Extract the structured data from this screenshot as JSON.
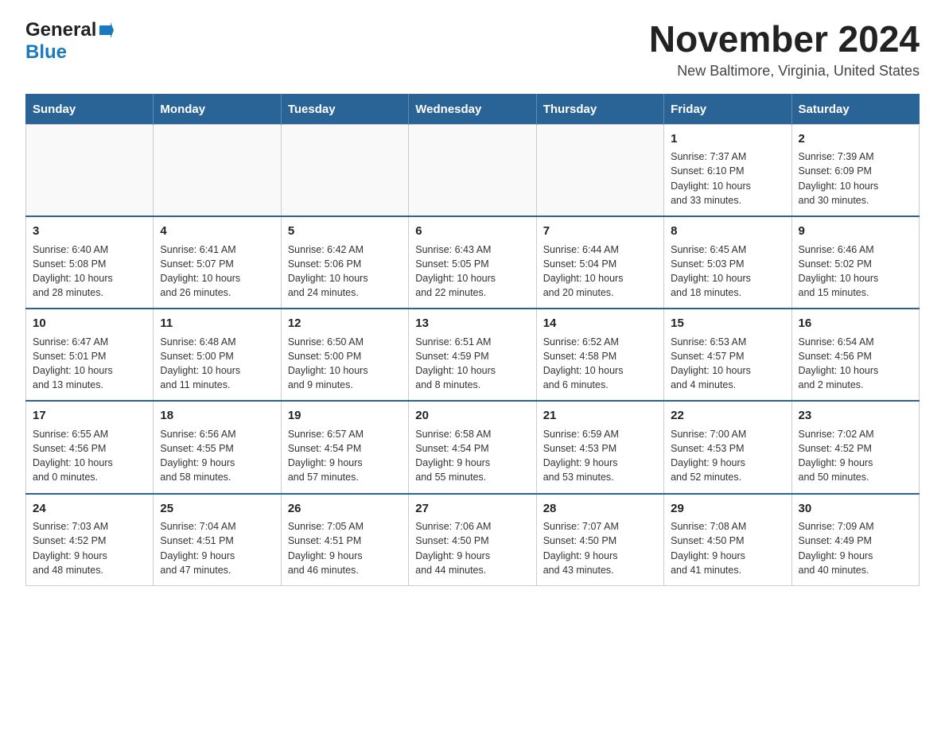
{
  "header": {
    "logo_general": "General",
    "logo_blue": "Blue",
    "month_title": "November 2024",
    "location": "New Baltimore, Virginia, United States"
  },
  "days_of_week": [
    "Sunday",
    "Monday",
    "Tuesday",
    "Wednesday",
    "Thursday",
    "Friday",
    "Saturday"
  ],
  "weeks": [
    [
      {
        "day": "",
        "info": ""
      },
      {
        "day": "",
        "info": ""
      },
      {
        "day": "",
        "info": ""
      },
      {
        "day": "",
        "info": ""
      },
      {
        "day": "",
        "info": ""
      },
      {
        "day": "1",
        "info": "Sunrise: 7:37 AM\nSunset: 6:10 PM\nDaylight: 10 hours\nand 33 minutes."
      },
      {
        "day": "2",
        "info": "Sunrise: 7:39 AM\nSunset: 6:09 PM\nDaylight: 10 hours\nand 30 minutes."
      }
    ],
    [
      {
        "day": "3",
        "info": "Sunrise: 6:40 AM\nSunset: 5:08 PM\nDaylight: 10 hours\nand 28 minutes."
      },
      {
        "day": "4",
        "info": "Sunrise: 6:41 AM\nSunset: 5:07 PM\nDaylight: 10 hours\nand 26 minutes."
      },
      {
        "day": "5",
        "info": "Sunrise: 6:42 AM\nSunset: 5:06 PM\nDaylight: 10 hours\nand 24 minutes."
      },
      {
        "day": "6",
        "info": "Sunrise: 6:43 AM\nSunset: 5:05 PM\nDaylight: 10 hours\nand 22 minutes."
      },
      {
        "day": "7",
        "info": "Sunrise: 6:44 AM\nSunset: 5:04 PM\nDaylight: 10 hours\nand 20 minutes."
      },
      {
        "day": "8",
        "info": "Sunrise: 6:45 AM\nSunset: 5:03 PM\nDaylight: 10 hours\nand 18 minutes."
      },
      {
        "day": "9",
        "info": "Sunrise: 6:46 AM\nSunset: 5:02 PM\nDaylight: 10 hours\nand 15 minutes."
      }
    ],
    [
      {
        "day": "10",
        "info": "Sunrise: 6:47 AM\nSunset: 5:01 PM\nDaylight: 10 hours\nand 13 minutes."
      },
      {
        "day": "11",
        "info": "Sunrise: 6:48 AM\nSunset: 5:00 PM\nDaylight: 10 hours\nand 11 minutes."
      },
      {
        "day": "12",
        "info": "Sunrise: 6:50 AM\nSunset: 5:00 PM\nDaylight: 10 hours\nand 9 minutes."
      },
      {
        "day": "13",
        "info": "Sunrise: 6:51 AM\nSunset: 4:59 PM\nDaylight: 10 hours\nand 8 minutes."
      },
      {
        "day": "14",
        "info": "Sunrise: 6:52 AM\nSunset: 4:58 PM\nDaylight: 10 hours\nand 6 minutes."
      },
      {
        "day": "15",
        "info": "Sunrise: 6:53 AM\nSunset: 4:57 PM\nDaylight: 10 hours\nand 4 minutes."
      },
      {
        "day": "16",
        "info": "Sunrise: 6:54 AM\nSunset: 4:56 PM\nDaylight: 10 hours\nand 2 minutes."
      }
    ],
    [
      {
        "day": "17",
        "info": "Sunrise: 6:55 AM\nSunset: 4:56 PM\nDaylight: 10 hours\nand 0 minutes."
      },
      {
        "day": "18",
        "info": "Sunrise: 6:56 AM\nSunset: 4:55 PM\nDaylight: 9 hours\nand 58 minutes."
      },
      {
        "day": "19",
        "info": "Sunrise: 6:57 AM\nSunset: 4:54 PM\nDaylight: 9 hours\nand 57 minutes."
      },
      {
        "day": "20",
        "info": "Sunrise: 6:58 AM\nSunset: 4:54 PM\nDaylight: 9 hours\nand 55 minutes."
      },
      {
        "day": "21",
        "info": "Sunrise: 6:59 AM\nSunset: 4:53 PM\nDaylight: 9 hours\nand 53 minutes."
      },
      {
        "day": "22",
        "info": "Sunrise: 7:00 AM\nSunset: 4:53 PM\nDaylight: 9 hours\nand 52 minutes."
      },
      {
        "day": "23",
        "info": "Sunrise: 7:02 AM\nSunset: 4:52 PM\nDaylight: 9 hours\nand 50 minutes."
      }
    ],
    [
      {
        "day": "24",
        "info": "Sunrise: 7:03 AM\nSunset: 4:52 PM\nDaylight: 9 hours\nand 48 minutes."
      },
      {
        "day": "25",
        "info": "Sunrise: 7:04 AM\nSunset: 4:51 PM\nDaylight: 9 hours\nand 47 minutes."
      },
      {
        "day": "26",
        "info": "Sunrise: 7:05 AM\nSunset: 4:51 PM\nDaylight: 9 hours\nand 46 minutes."
      },
      {
        "day": "27",
        "info": "Sunrise: 7:06 AM\nSunset: 4:50 PM\nDaylight: 9 hours\nand 44 minutes."
      },
      {
        "day": "28",
        "info": "Sunrise: 7:07 AM\nSunset: 4:50 PM\nDaylight: 9 hours\nand 43 minutes."
      },
      {
        "day": "29",
        "info": "Sunrise: 7:08 AM\nSunset: 4:50 PM\nDaylight: 9 hours\nand 41 minutes."
      },
      {
        "day": "30",
        "info": "Sunrise: 7:09 AM\nSunset: 4:49 PM\nDaylight: 9 hours\nand 40 minutes."
      }
    ]
  ]
}
